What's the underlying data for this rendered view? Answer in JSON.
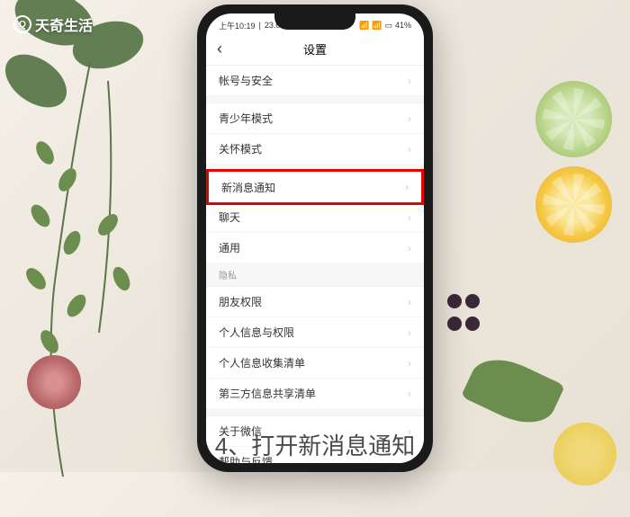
{
  "watermark": {
    "text": "天奇生活"
  },
  "status_bar": {
    "time": "上午10:19",
    "speed": "23.0K/s",
    "battery": "41%"
  },
  "nav": {
    "title": "设置"
  },
  "settings": {
    "items": [
      {
        "label": "帐号与安全",
        "highlighted": false
      },
      {
        "label": "青少年模式",
        "highlighted": false
      },
      {
        "label": "关怀模式",
        "highlighted": false
      },
      {
        "label": "新消息通知",
        "highlighted": true
      },
      {
        "label": "聊天",
        "highlighted": false
      },
      {
        "label": "通用",
        "highlighted": false
      }
    ],
    "privacy_header": "隐私",
    "privacy_items": [
      {
        "label": "朋友权限"
      },
      {
        "label": "个人信息与权限"
      },
      {
        "label": "个人信息收集清单"
      },
      {
        "label": "第三方信息共享清单"
      }
    ],
    "about_items": [
      {
        "label": "关于微信"
      },
      {
        "label": "帮助与反馈"
      }
    ]
  },
  "caption": "4、打开新消息通知"
}
